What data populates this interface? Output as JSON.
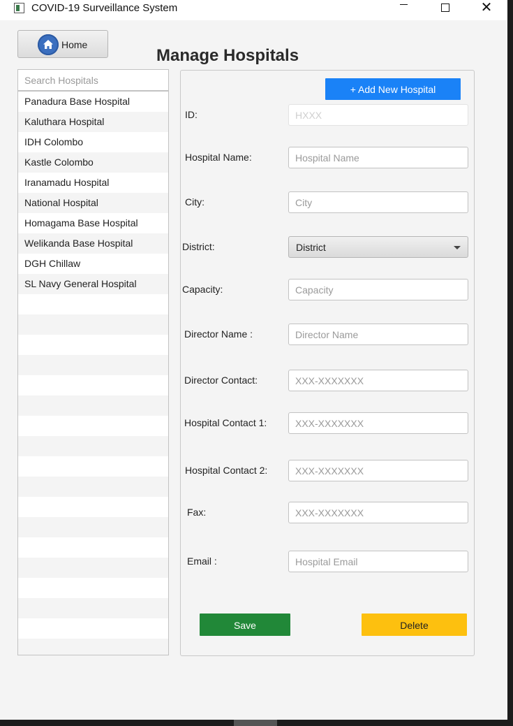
{
  "window": {
    "title": "COVID-19 Surveillance System",
    "icons": {
      "app": "app-icon",
      "minimize": "minimize-icon",
      "maximize": "maximize-icon",
      "close": "close-icon"
    },
    "close_glyph": "✕"
  },
  "home_button": {
    "label": "Home",
    "icon": "home-icon"
  },
  "page_title": "Manage Hospitals",
  "search": {
    "placeholder": "Search Hospitals",
    "value": ""
  },
  "hospitals": [
    "Panadura Base Hospital",
    "Kaluthara Hospital",
    "IDH Colombo",
    "Kastle Colombo",
    "Iranamadu Hospital",
    "National Hospital",
    "Homagama Base Hospital",
    "Welikanda Base Hospital",
    "DGH Chillaw",
    "SL Navy General Hospital"
  ],
  "form": {
    "add_button": "+ Add New Hospital",
    "fields": {
      "id": {
        "label": "ID:",
        "placeholder": "HXXX",
        "value": ""
      },
      "name": {
        "label": "Hospital Name:",
        "placeholder": "Hospital Name",
        "value": ""
      },
      "city": {
        "label": "City:",
        "placeholder": "City",
        "value": ""
      },
      "district": {
        "label": "District:",
        "selected": "District"
      },
      "capacity": {
        "label": "Capacity:",
        "placeholder": "Capacity",
        "value": ""
      },
      "director_name": {
        "label": "Director Name :",
        "placeholder": "Director Name",
        "value": ""
      },
      "director_contact": {
        "label": "Director Contact:",
        "placeholder": "XXX-XXXXXXX",
        "value": ""
      },
      "contact1": {
        "label": "Hospital Contact 1:",
        "placeholder": "XXX-XXXXXXX",
        "value": ""
      },
      "contact2": {
        "label": "Hospital Contact 2:",
        "placeholder": "XXX-XXXXXXX",
        "value": ""
      },
      "fax": {
        "label": "Fax:",
        "placeholder": "XXX-XXXXXXX",
        "value": ""
      },
      "email": {
        "label": "Email :",
        "placeholder": "Hospital Email",
        "value": ""
      }
    },
    "save_button": "Save",
    "delete_button": "Delete"
  },
  "colors": {
    "add_button": "#1a82f7",
    "save_button": "#218838",
    "delete_button": "#fdc00f",
    "home_icon": "#3b6fbf"
  }
}
